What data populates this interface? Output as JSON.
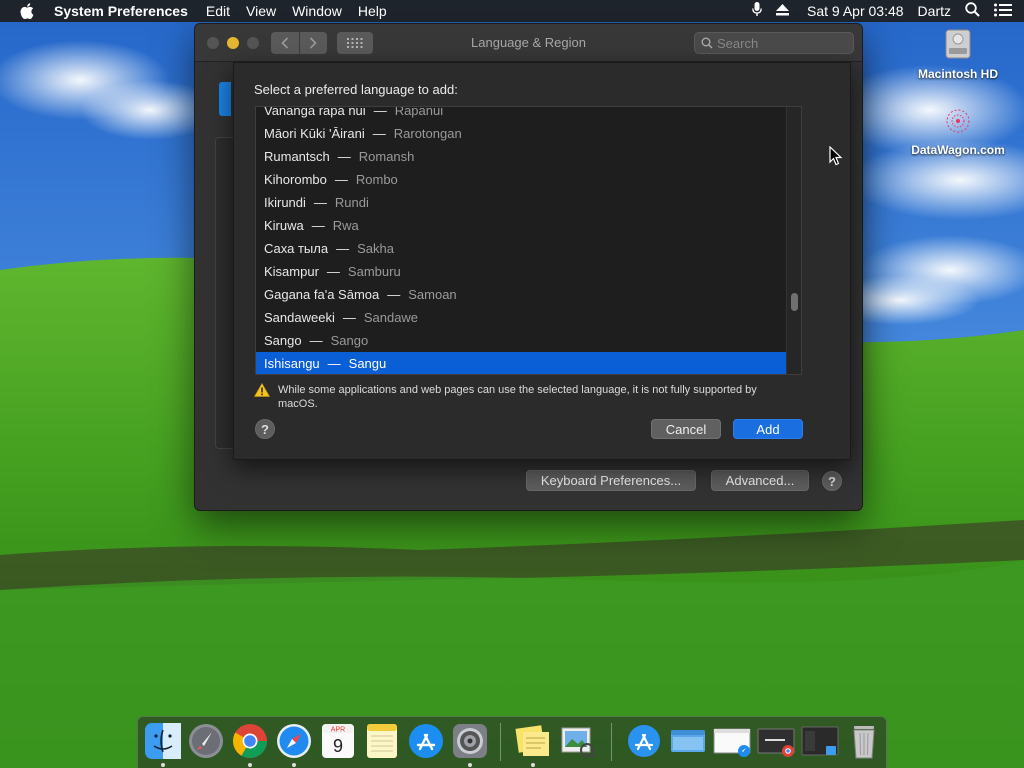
{
  "menubar": {
    "app_name": "System Preferences",
    "menus": [
      "Edit",
      "View",
      "Window",
      "Help"
    ],
    "clock": "Sat 9 Apr  03:48",
    "user": "Dartz"
  },
  "desktop": {
    "icons": [
      {
        "label": "Macintosh HD"
      },
      {
        "label": "DataWagon.com"
      }
    ]
  },
  "window": {
    "title": "Language & Region",
    "search_placeholder": "Search",
    "keyboard_prefs_label": "Keyboard Preferences...",
    "advanced_label": "Advanced...",
    "help_label": "?"
  },
  "sheet": {
    "prompt": "Select a preferred language to add:",
    "languages": [
      {
        "native": "Vananga rapa nui",
        "english": "Rapanui"
      },
      {
        "native": "Māori Kūki 'Āirani",
        "english": "Rarotongan"
      },
      {
        "native": "Rumantsch",
        "english": "Romansh"
      },
      {
        "native": "Kihorombo",
        "english": "Rombo"
      },
      {
        "native": "Ikirundi",
        "english": "Rundi"
      },
      {
        "native": "Kiruwa",
        "english": "Rwa"
      },
      {
        "native": "Саха тыла",
        "english": "Sakha"
      },
      {
        "native": "Kisampur",
        "english": "Samburu"
      },
      {
        "native": "Gagana fa'a Sāmoa",
        "english": "Samoan"
      },
      {
        "native": "Sandaweeki",
        "english": "Sandawe"
      },
      {
        "native": "Sango",
        "english": "Sango"
      },
      {
        "native": "Ishisangu",
        "english": "Sangu"
      }
    ],
    "separator": "—",
    "selected_index": 11,
    "scroll_position_fraction": 0.74,
    "warning": "While some applications and web pages can use the selected language, it is not fully supported by macOS.",
    "cancel_label": "Cancel",
    "add_label": "Add",
    "help_label": "?"
  },
  "dock": {
    "apps": [
      "finder-icon",
      "launchpad-icon",
      "chrome-icon",
      "safari-icon",
      "calendar-icon",
      "notes-icon",
      "app-store-icon",
      "system-preferences-icon",
      "stickies-icon",
      "preview-icon",
      "app-store-folder-icon",
      "finder-window-icon",
      "safari-window-icon",
      "chrome-window-icon",
      "finder-window-2-icon",
      "trash-icon"
    ],
    "calendar_month": "APR",
    "calendar_day": "9"
  },
  "colors": {
    "accent": "#0a5ed6",
    "window_bg": "#323232",
    "sheet_bg": "#2b2b2b"
  }
}
